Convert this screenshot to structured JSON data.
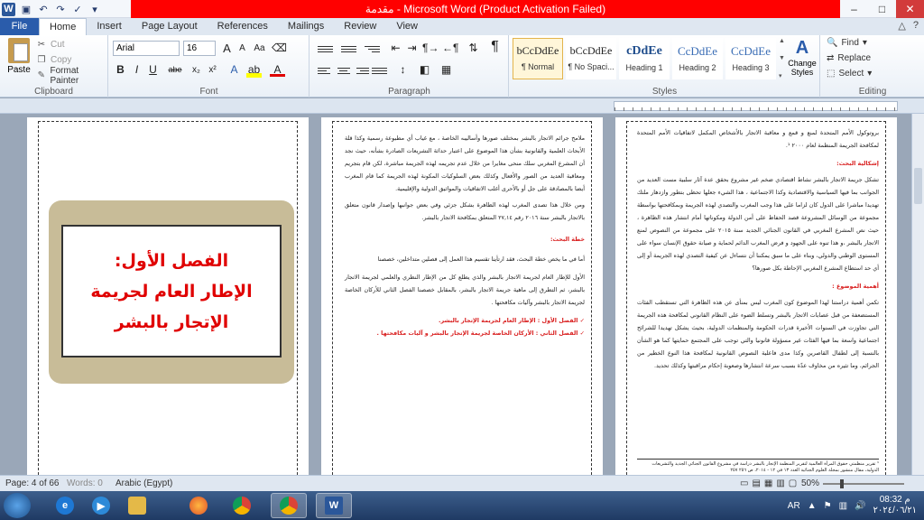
{
  "window": {
    "title": "مقدمة - Microsoft Word (Product Activation Failed)",
    "controls": [
      "–",
      "□",
      "✕"
    ]
  },
  "qat": {
    "icons": [
      "word-icon",
      "save-icon",
      "undo-icon",
      "redo-icon",
      "spelling-icon",
      "customize-icon"
    ]
  },
  "tabs": {
    "file": "File",
    "items": [
      "Home",
      "Insert",
      "Page Layout",
      "References",
      "Mailings",
      "Review",
      "View"
    ],
    "active": "Home"
  },
  "clipboard": {
    "paste": "Paste",
    "cut": "Cut",
    "copy": "Copy",
    "format_painter": "Format Painter",
    "label": "Clipboard"
  },
  "font": {
    "name": "Arial",
    "size": "16",
    "grow": "A",
    "shrink": "A",
    "case": "Aa",
    "bold": "B",
    "italic": "I",
    "underline": "U",
    "strike": "abe",
    "subscript": "x₂",
    "superscript": "x²",
    "label": "Font"
  },
  "paragraph": {
    "label": "Paragraph",
    "pilcrow": "¶"
  },
  "styles": {
    "label": "Styles",
    "items": [
      {
        "sample": "bCcDdEe",
        "name": "¶ Normal"
      },
      {
        "sample": "bCcDdEe",
        "name": "¶ No Spaci..."
      },
      {
        "sample": "cDdEe",
        "name": "Heading 1"
      },
      {
        "sample": "CcDdEe",
        "name": "Heading 2"
      },
      {
        "sample": "CcDdEe",
        "name": "Heading 3"
      }
    ],
    "change": "Change Styles"
  },
  "editing": {
    "label": "Editing",
    "find": "Find",
    "replace": "Replace",
    "select": "Select"
  },
  "pages": {
    "chapter": {
      "line1": "الفصل الأول:",
      "line2": "الإطار العام لجريمة",
      "line3": "الإتجار بالبشر"
    },
    "middle": {
      "p1": "ملامح جرائم الاتجار بالبشر بمختلف صورها وأساليبه الخاصة ، مع غياب أي مطبوعة رسمية وكذا قلة الأبحاث العلمية والقانونية بشأن هذا الموضوع على اعتبار حداثة التشريعات الصادرة بشأنه، حيث نجد أن المشرع المغربي سلك منحى مغايرا من خلال عدم تجريمه لهذه الجريمة مباشرة، لكن قام بتجريم ومعاقبة العديد من الصور والأفعال وكذلك بعض السلوكيات المكونة لهذه الجريمة كما قام المغرب أيضا بالمصادقة على جل أو بالأحرى أغلب الاتفاقيات والمواثيق الدولية والإقليمية.",
      "p2": "ومن خلال هذا تصدى المغرب لهذه الظاهرة بشكل جزئي وفي بعض جوانبها وإصدار قانون متعلق بالاتجار بالبشر سنة ٢٠١٦ رقم ٢٧,١٤ المتعلق بمكافحة الاتجار بالبشر.",
      "heading": "خطة البحث:",
      "p3": "أما في ما يخص خطة البحث، فقد ارتأينا تقسيم هذا العمل إلى فصلين متداخلين، خصصنا",
      "p4": "الأول للإطار العام لجريمة الاتجار بالبشر والذي يطلع كل من الإطار النظري والعلمي لجريمة الاتجار بالبشر، ثم التطرق إلى ماهية جريمة الاتجار بالبشر، بالمقابل خصصنا الفصل الثاني للأركان الخاصة لجريمة الاتجار بالبشر وآليات مكافحتها .",
      "item1": "✓ الفصل الأول : الإطار العام لجريمة الإتجار بالبشر.",
      "item2": "✓ الفصل الثاني : الأركان الخاصة لجريمة الإتجار بالبشر و آليات مكافحتها ."
    },
    "right": {
      "p1": "بروتوكول الأمم المتحدة لمنع و قمع و معاقبة الاتجار بالأشخاص المكمل لاتفاقيات الأمم المتحدة لمكافحة الجريمة المنظمة لعام ٢٠٠٠ ¹.",
      "heading1": "إشكالية البحث:",
      "p2": "تشكل جريمة الاتجار بالبشر نشاط اقتصادي ضخم غير مشروع بحقق عدة آثار سلبية مست العديد من الجوانب بما فيها السياسية والاقتصادية وكذا الاجتماعية ، هذا الشيء جعلها تحظى بتطور وازدهار ملتك تهديدا مباشرا على الدول كان لزاما على هذا وجب المغرب والتصدي لهذه الجريمة وبمكافحتها بواسطة مجموعة من الوسائل المشروعة قصد الحفاظ على أمن الدولة ومكوناتها أمام انتشار هذه الظاهرة ، حيث نص المشرع المغربي في القانون الجنائي الجديد سنة ٢٠١٥ على مجموعة من النصوص لمنع الاتجار بالبشر ،و هذا تنوه على الجهود و فرض المغرب الدائم لحماية و صيانة حقوق الإنسان سواء على المستوى الوطني والدولي، وبناء على ما سبق يمكننا أن نتساءل عن كيفية التصدي لهذه الجريمة أو إلى أي حد استطاع المشرع المغربي الإحاطة بكل صورها؟",
      "heading2": "أهمية الموضوع :",
      "p3": "تكمن أهمية دراستنا لهذا الموضوع كون المغرب ليس بمنأى عن هذه الظاهرة التي تستقطب الفئات المستضعفة من قبل عصابات الاتجار بالبشر وتسلط الضوء على النظام القانوني لمكافحة هذه الجريمة التي تجاوزت في السنوات الأخيرة قدرات الحكومة والمنظمات الدولية، بحيث يشكل تهديدا للشرائح اجتماعية واسعة بما فيها الفئات غير مسؤولة قانونيا والتي توجب على المجتمع حمايتها كما هو الشأن بالنسبة إلى لطفال القاصرين وكذا مدى فاعلية النصوص القانونية لمكافحة هذا النوع الخطير من الجرائم، وما تثيره من مخاوف عدّة بسبب سرعة انتشارها وصعوبة إحكام مراقبتها وكذلك تحديد.",
      "footnote": "¹ تقرير منظمتي حقوق المرأة العالمية لتقرير المنظمة الإتجار بالبشر دراسة في مشروع القانون الجنائي الجديد والتشريعات الدولية، مقال منشور بمجلة العلوم الجنائية العدد ١٣ في ١٢ - ٢٠١٤، ص ٢٥٦ ٢٥٧"
    }
  },
  "status": {
    "page": "Page: 4 of 66",
    "words": "Words: 0",
    "language": "Arabic (Egypt)",
    "zoom": "50%",
    "zoom_level_percent": 50
  },
  "taskbar": {
    "apps": [
      "ie-icon",
      "media-player-icon",
      "folder-icon",
      "firefox-icon",
      "chrome-icon",
      "chrome-icon",
      "word-icon"
    ],
    "lang": "AR",
    "time": "08:32 م",
    "date": "٢٠٢٤/٠٦/٢١"
  },
  "colors": {
    "title_bar_warning": "#ff0000",
    "file_tab": "#2a5cab",
    "chapter_text": "#e00000",
    "chapter_frame": "#c8bc98"
  }
}
